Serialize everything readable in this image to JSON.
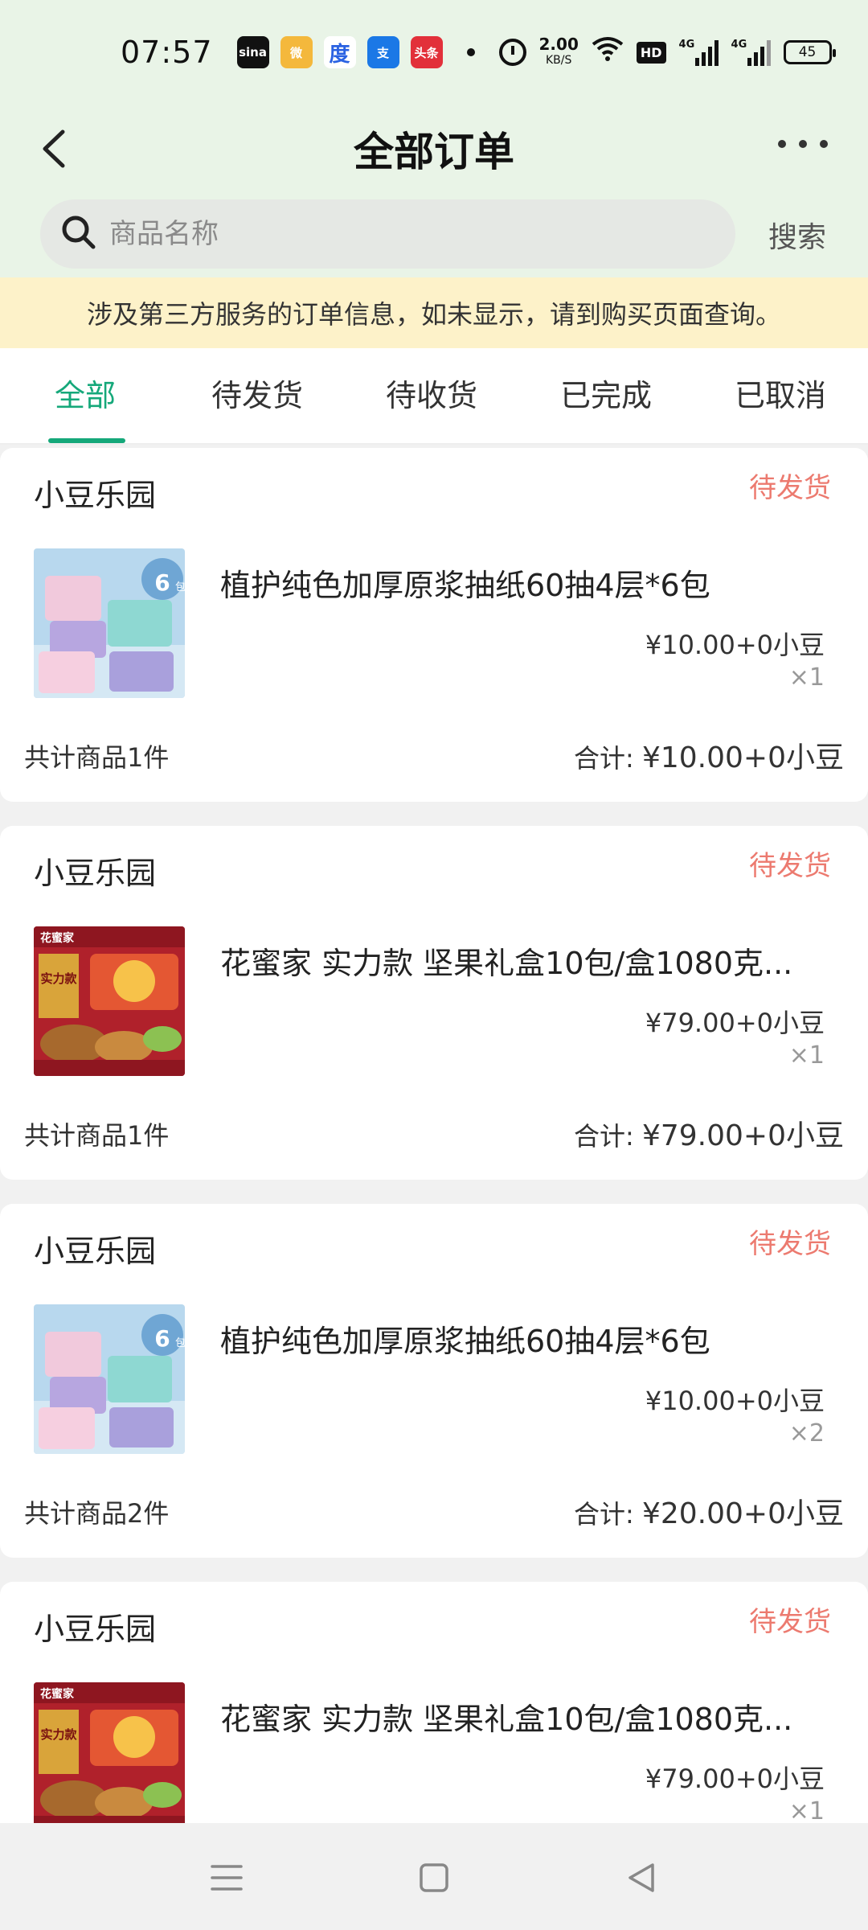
{
  "status_bar": {
    "time": "07:57",
    "app_icons": [
      "sina",
      "微",
      "度",
      "支",
      "头条"
    ],
    "net_speed_value": "2.00",
    "net_speed_unit": "KB/S",
    "hd_label": "HD",
    "signal1_label": "4G",
    "signal2_label": "4G",
    "battery": "45"
  },
  "header": {
    "title": "全部订单"
  },
  "search": {
    "placeholder": "商品名称",
    "button_label": "搜索"
  },
  "notice": "涉及第三方服务的订单信息，如未显示，请到购买页面查询。",
  "tabs": [
    {
      "label": "全部",
      "active": true
    },
    {
      "label": "待发货",
      "active": false
    },
    {
      "label": "待收货",
      "active": false
    },
    {
      "label": "已完成",
      "active": false
    },
    {
      "label": "已取消",
      "active": false
    }
  ],
  "orders": [
    {
      "shop": "小豆乐园",
      "status": "待发货",
      "product": "植护纯色加厚原浆抽纸60抽4层*6包",
      "thumb": "tissue",
      "badge": "6",
      "badge_label": "包",
      "price": "¥10.00+0小豆",
      "qty": "×1",
      "count_text": "共计商品1件",
      "total_label": "合计:",
      "total_value": "¥10.00+0小豆"
    },
    {
      "shop": "小豆乐园",
      "status": "待发货",
      "product": "花蜜家 实力款 坚果礼盒10包/盒1080克...",
      "thumb": "nuts",
      "badge": "实力款",
      "badge_label": "花蜜家",
      "price": "¥79.00+0小豆",
      "qty": "×1",
      "count_text": "共计商品1件",
      "total_label": "合计:",
      "total_value": "¥79.00+0小豆"
    },
    {
      "shop": "小豆乐园",
      "status": "待发货",
      "product": "植护纯色加厚原浆抽纸60抽4层*6包",
      "thumb": "tissue",
      "badge": "6",
      "badge_label": "包",
      "price": "¥10.00+0小豆",
      "qty": "×2",
      "count_text": "共计商品2件",
      "total_label": "合计:",
      "total_value": "¥20.00+0小豆"
    },
    {
      "shop": "小豆乐园",
      "status": "待发货",
      "product": "花蜜家 实力款 坚果礼盒10包/盒1080克...",
      "thumb": "nuts",
      "badge": "实力款",
      "badge_label": "花蜜家",
      "price": "¥79.00+0小豆",
      "qty": "×1",
      "count_text": "",
      "total_label": "",
      "total_value": ""
    }
  ],
  "colors": {
    "accent": "#15a87a",
    "status": "#ec7a6f",
    "notice_bg": "#fdf2c9",
    "header_bg": "#e9f4e7"
  },
  "icons": {
    "back": "chevron-left-icon",
    "more": "more-dots-icon",
    "search": "search-icon",
    "nav_menu": "menu-icon",
    "nav_home": "home-square-icon",
    "nav_back": "triangle-back-icon"
  }
}
